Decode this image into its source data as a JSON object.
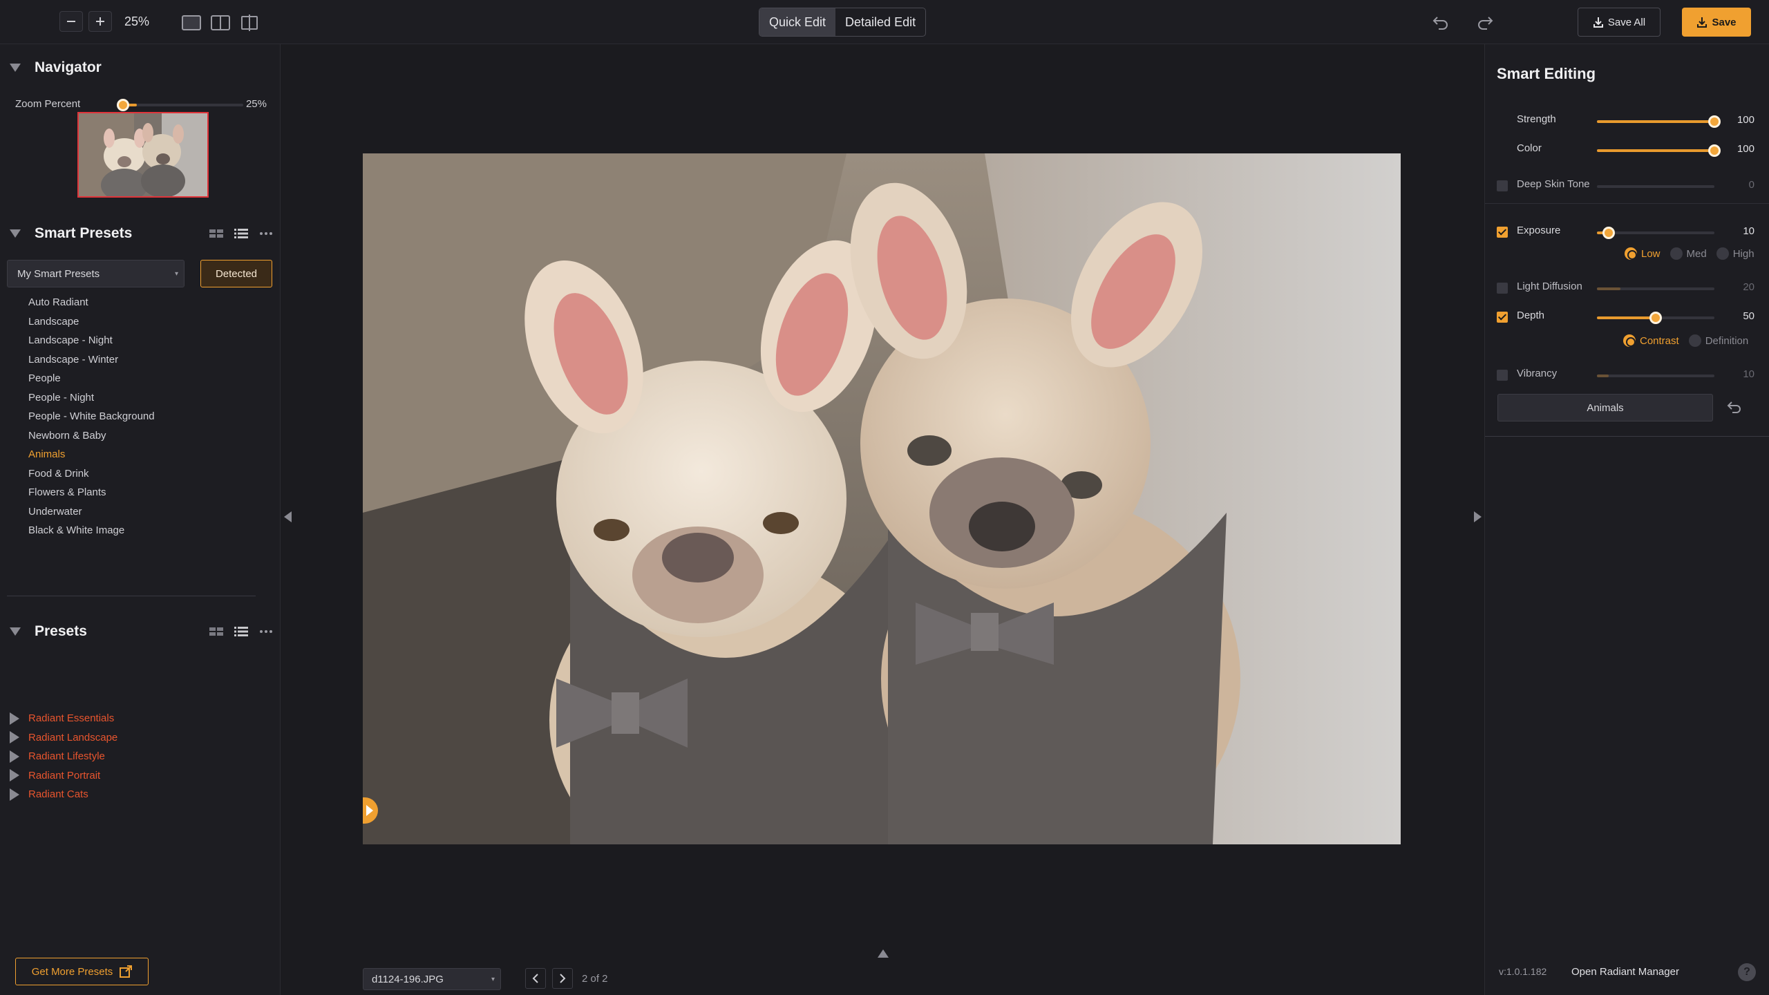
{
  "toolbar": {
    "zoom_out_icon": "minus-icon",
    "zoom_in_icon": "plus-icon",
    "zoom_level": "25%",
    "view_modes": [
      "single-view-icon",
      "split-view-icon",
      "compare-view-icon"
    ],
    "quick_edit_label": "Quick Edit",
    "detailed_edit_label": "Detailed Edit",
    "save_all_label": "Save All",
    "save_label": "Save"
  },
  "navigator": {
    "title": "Navigator",
    "zoom_label": "Zoom Percent",
    "zoom_value": "25%",
    "zoom_fraction": 0.25
  },
  "smart_presets": {
    "title": "Smart Presets",
    "select_value": "My Smart Presets",
    "detected_label": "Detected",
    "items": [
      {
        "label": "Auto Radiant"
      },
      {
        "label": "Landscape"
      },
      {
        "label": "Landscape - Night"
      },
      {
        "label": "Landscape - Winter"
      },
      {
        "label": "People"
      },
      {
        "label": "People - Night"
      },
      {
        "label": "People - White Background"
      },
      {
        "label": "Newborn & Baby"
      },
      {
        "label": "Animals"
      },
      {
        "label": "Food & Drink"
      },
      {
        "label": "Flowers & Plants"
      },
      {
        "label": "Underwater"
      },
      {
        "label": "Black & White Image"
      }
    ],
    "active_item": "Animals"
  },
  "presets": {
    "title": "Presets",
    "items": [
      {
        "label": "Radiant Essentials"
      },
      {
        "label": "Radiant Landscape"
      },
      {
        "label": "Radiant Lifestyle"
      },
      {
        "label": "Radiant Portrait"
      },
      {
        "label": "Radiant Cats"
      }
    ],
    "get_more_label": "Get More Presets"
  },
  "canvas": {
    "file_name": "d1124-196.JPG",
    "page_label": "2 of 2"
  },
  "smart_editing": {
    "title": "Smart Editing",
    "sliders": [
      {
        "label": "Strength",
        "value": "100",
        "checkbox": null,
        "level": 1.0
      },
      {
        "label": "Color",
        "value": "100",
        "checkbox": null,
        "level": 1.0
      },
      {
        "label": "Deep Skin Tone",
        "value": "0",
        "checkbox": false,
        "level": 0.0
      },
      {
        "label": "Exposure",
        "value": "10",
        "checkbox": true,
        "level": 0.1
      },
      {
        "label": "Light Diffusion",
        "value": "20",
        "checkbox": false,
        "level": 0.2
      },
      {
        "label": "Depth",
        "value": "50",
        "checkbox": true,
        "level": 0.5
      },
      {
        "label": "Vibrancy",
        "value": "10",
        "checkbox": false,
        "level": 0.1
      }
    ],
    "exposure_options": [
      {
        "label": "Low",
        "selected": true
      },
      {
        "label": "Med",
        "selected": false
      },
      {
        "label": "High",
        "selected": false
      }
    ],
    "depth_options": [
      {
        "label": "Contrast",
        "selected": true
      },
      {
        "label": "Definition",
        "selected": false
      }
    ],
    "preset_button_label": "Animals"
  },
  "footer": {
    "version": "v:1.0.1.182",
    "manager_link": "Open Radiant Manager",
    "help_label": "?"
  },
  "colors": {
    "accent": "#f0a030",
    "preset_link": "#e8552e",
    "background": "#1b1b1f",
    "panel": "#1d1d22"
  }
}
